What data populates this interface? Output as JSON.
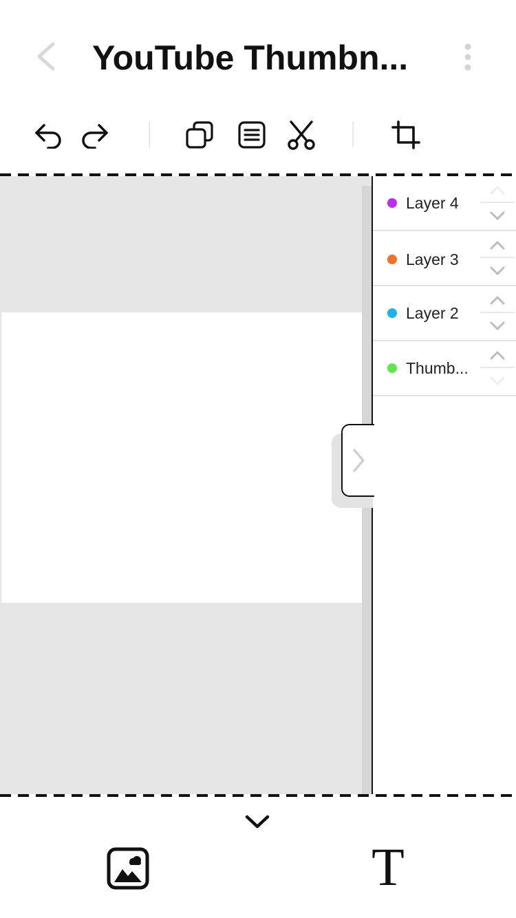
{
  "header": {
    "title": "YouTube Thumbn...",
    "back_icon": "chevron-left-icon",
    "more_icon": "more-vertical-icon"
  },
  "toolbar": {
    "undo_icon": "undo-icon",
    "redo_icon": "redo-icon",
    "duplicate_icon": "duplicate-icon",
    "properties_icon": "text-align-icon",
    "cut_icon": "scissors-icon",
    "crop_icon": "crop-icon"
  },
  "layers": [
    {
      "name": "Layer 4",
      "color": "#b92ff0"
    },
    {
      "name": "Layer 3",
      "color": "#f57224"
    },
    {
      "name": "Layer 2",
      "color": "#1bb2ee"
    },
    {
      "name": "Thumb...",
      "color": "#5fe84a"
    }
  ],
  "bottom": {
    "toggle_icon": "chevron-down-icon",
    "add_image_icon": "image-icon",
    "add_text_label": "T"
  },
  "colors": {
    "canvas_background": "#e6e6e6",
    "canvas_page": "#ffffff",
    "accent": "#111111"
  }
}
